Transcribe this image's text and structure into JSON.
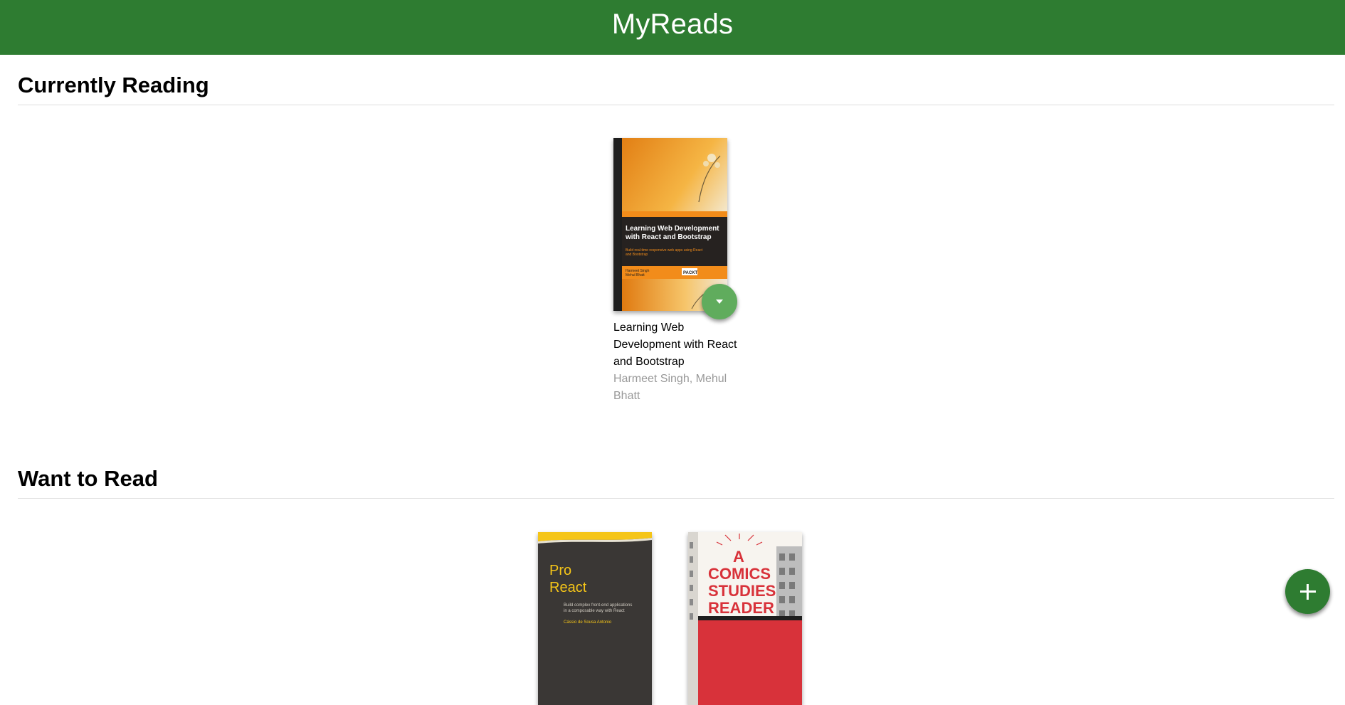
{
  "header": {
    "title": "MyReads"
  },
  "shelves": [
    {
      "title": "Currently Reading",
      "books": [
        {
          "title": "Learning Web Development with React and Bootstrap",
          "authors": "Harmeet Singh, Mehul Bhatt",
          "cover": {
            "title": "Learning Web Development with React and Bootstrap",
            "subtitle": "Build real-time responsive web apps using React and Bootstrap",
            "authors_line1": "Harmeet Singh",
            "authors_line2": "Mehul Bhatt",
            "publisher": "PACKT"
          }
        }
      ]
    },
    {
      "title": "Want to Read",
      "books": [
        {
          "cover": {
            "title_line1": "Pro",
            "title_line2": "React",
            "subtitle": "Build complex front-end applications in a composable way with React",
            "author": "Cássio de Sousa Antonio"
          }
        },
        {
          "cover": {
            "title_line1": "A",
            "title_line2": "COMICS",
            "title_line3": "STUDIES",
            "title_line4": "READER"
          }
        }
      ]
    }
  ],
  "icons": {
    "shelf_changer": "caret-down-icon",
    "add": "plus-icon"
  },
  "colors": {
    "header_bg": "#2e7c31",
    "shelf_changer_bg": "#60ac5d",
    "add_button_bg": "#2e7c31",
    "author_text": "#999999"
  }
}
